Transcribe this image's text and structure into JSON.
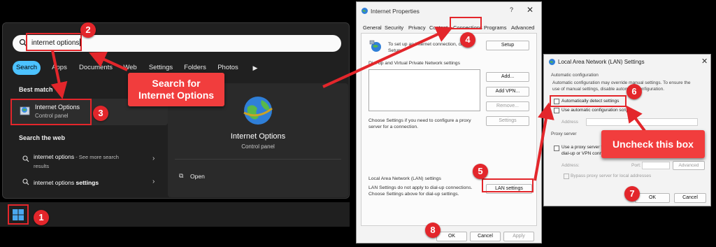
{
  "start_menu": {
    "search_value": "internet options",
    "tabs": [
      "Search",
      "Apps",
      "Documents",
      "Web",
      "Settings",
      "Folders",
      "Photos"
    ],
    "active_tab": "Search",
    "best_match_heading": "Best match",
    "best_match": {
      "title": "Internet Options",
      "subtitle": "Control panel"
    },
    "web_heading": "Search the web",
    "web_results": [
      {
        "title": "internet options",
        "extra": " - See more search",
        "extra2": "results"
      },
      {
        "title": "internet options ",
        "bold": "settings"
      }
    ],
    "preview": {
      "title": "Internet Options",
      "subtitle": "Control panel",
      "open_label": "Open"
    }
  },
  "internet_properties": {
    "title": "Internet Properties",
    "help": "?",
    "tabs": [
      "General",
      "Security",
      "Privacy",
      "Content",
      "Connections",
      "Programs",
      "Advanced"
    ],
    "setup_text_1": "To set up an Internet connection, click",
    "setup_text_2": "Setup.",
    "setup_button": "Setup",
    "dialup_heading": "Dial-up and Virtual Private Network settings",
    "add_button": "Add...",
    "add_vpn_button": "Add VPN...",
    "remove_button": "Remove...",
    "settings_button": "Settings",
    "choose_text_1": "Choose Settings if you need to configure a proxy",
    "choose_text_2": "server for a connection.",
    "lan_heading": "Local Area Network (LAN) settings",
    "lan_text_1": "LAN Settings do not apply to dial-up connections.",
    "lan_text_2": "Choose Settings above for dial-up settings.",
    "lan_button": "LAN settings",
    "ok_button": "OK",
    "cancel_button": "Cancel",
    "apply_button": "Apply"
  },
  "lan_settings": {
    "title": "Local Area Network (LAN) Settings",
    "auto_heading": "Automatic configuration",
    "auto_text_1": "Automatic configuration may override manual settings.  To ensure the",
    "auto_text_2": "use of manual settings, disable automatic configuration.",
    "auto_detect": "Automatically detect settings",
    "auto_detect_checked": false,
    "use_script": "Use automatic configuration script",
    "address_label": "Address",
    "proxy_heading": "Proxy server",
    "use_proxy_1": "Use a proxy server for your LAN (These settings will not apply to",
    "use_proxy_2": "dial-up or VPN connections).",
    "proxy_address_label": "Address:",
    "port_label": "Port:",
    "advanced_button": "Advanced",
    "bypass_label": "Bypass proxy server for local addresses",
    "ok_button": "OK",
    "cancel_button": "Cancel"
  },
  "annotations": {
    "search_callout": "Search for\nInternet Options",
    "uncheck_callout": "Uncheck this box",
    "badges": [
      "1",
      "2",
      "3",
      "4",
      "5",
      "6",
      "7",
      "8"
    ],
    "color": "#e3262b"
  }
}
